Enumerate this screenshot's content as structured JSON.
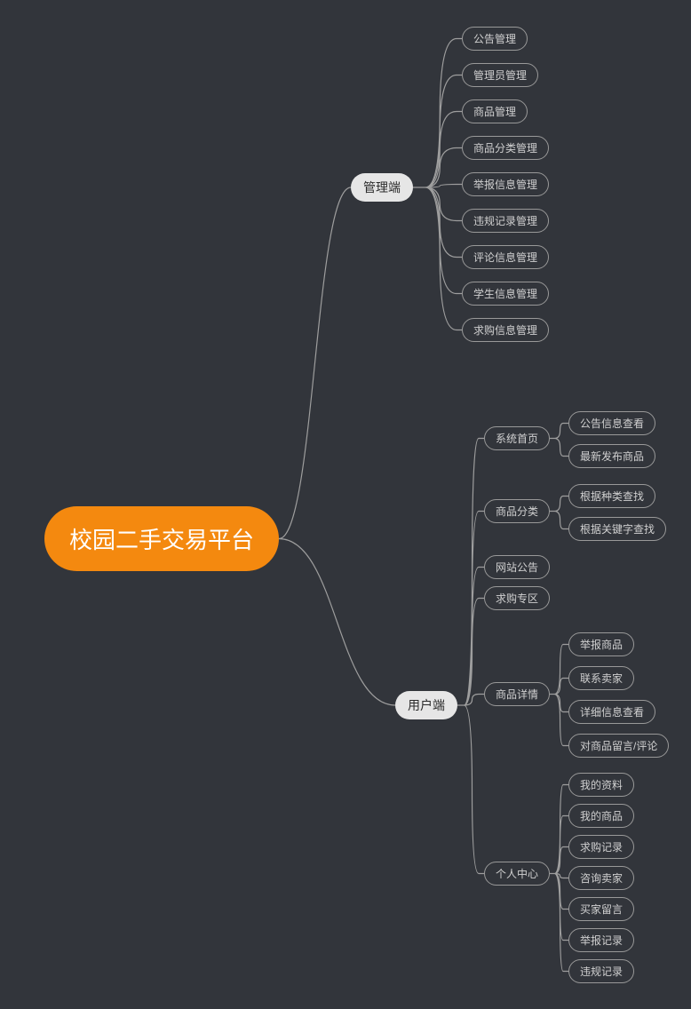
{
  "root": "校园二手交易平台",
  "branches": {
    "admin": {
      "label": "管理端",
      "children": [
        "公告管理",
        "管理员管理",
        "商品管理",
        "商品分类管理",
        "举报信息管理",
        "违规记录管理",
        "评论信息管理",
        "学生信息管理",
        "求购信息管理"
      ]
    },
    "user": {
      "label": "用户端",
      "children": [
        {
          "label": "系统首页",
          "children": [
            "公告信息查看",
            "最新发布商品"
          ]
        },
        {
          "label": "商品分类",
          "children": [
            "根据种类查找",
            "根据关键字查找"
          ]
        },
        {
          "label": "网站公告",
          "children": []
        },
        {
          "label": "求购专区",
          "children": []
        },
        {
          "label": "商品详情",
          "children": [
            "举报商品",
            "联系卖家",
            "详细信息查看",
            "对商品留言/评论"
          ]
        },
        {
          "label": "个人中心",
          "children": [
            "我的资料",
            "我的商品",
            "求购记录",
            "咨询卖家",
            "买家留言",
            "举报记录",
            "违规记录"
          ]
        }
      ]
    }
  }
}
